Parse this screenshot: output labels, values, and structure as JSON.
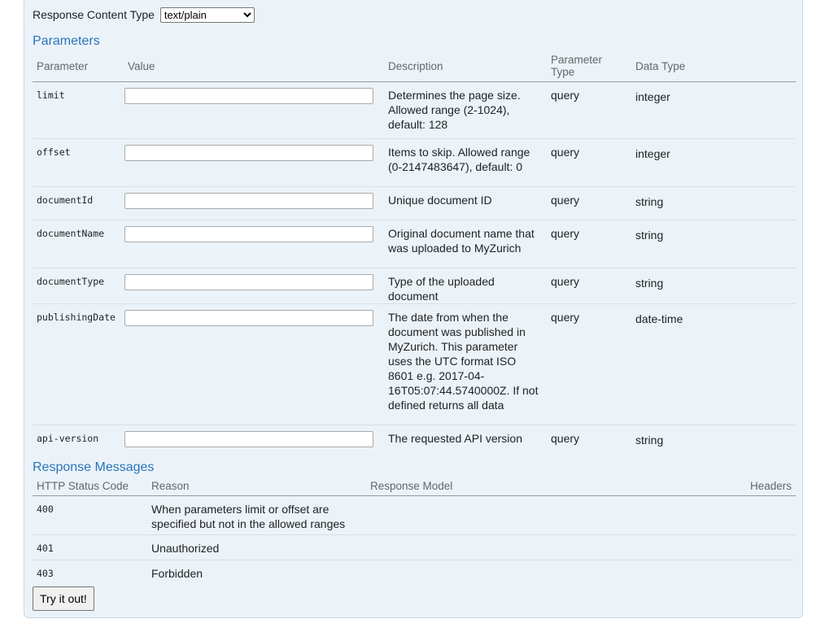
{
  "response_content_type": {
    "label": "Response Content Type",
    "value": "text/plain"
  },
  "parameters": {
    "title": "Parameters",
    "headers": [
      "Parameter",
      "Value",
      "Description",
      "Parameter Type",
      "Data Type"
    ],
    "rows": [
      {
        "name": "limit",
        "value": "",
        "description": "Determines the page size. Allowed range (2-1024), default: 128",
        "param_type": "query",
        "data_type": "integer"
      },
      {
        "name": "offset",
        "value": "",
        "description": "Items to skip. Allowed range (0-2147483647), default: 0",
        "param_type": "query",
        "data_type": "integer"
      },
      {
        "name": "documentId",
        "value": "",
        "description": "Unique document ID",
        "param_type": "query",
        "data_type": "string"
      },
      {
        "name": "documentName",
        "value": "",
        "description": "Original document name that was uploaded to MyZurich",
        "param_type": "query",
        "data_type": "string"
      },
      {
        "name": "documentType",
        "value": "",
        "description": "Type of the uploaded document",
        "param_type": "query",
        "data_type": "string"
      },
      {
        "name": "publishingDate",
        "value": "",
        "description": "The date from when the document was published in MyZurich. This parameter uses the UTC format ISO 8601 e.g. 2017-04-16T05:07:44.5740000Z. If not defined returns all data",
        "param_type": "query",
        "data_type": "date-time"
      },
      {
        "name": "api-version",
        "value": "",
        "description": "The requested API version",
        "param_type": "query",
        "data_type": "string"
      }
    ]
  },
  "responses": {
    "title": "Response Messages",
    "headers": [
      "HTTP Status Code",
      "Reason",
      "Response Model",
      "Headers"
    ],
    "rows": [
      {
        "code": "400",
        "reason": "When parameters limit or offset are specified but not in the allowed ranges"
      },
      {
        "code": "401",
        "reason": "Unauthorized"
      },
      {
        "code": "403",
        "reason": "Forbidden"
      }
    ]
  },
  "try_button": "Try it out!"
}
